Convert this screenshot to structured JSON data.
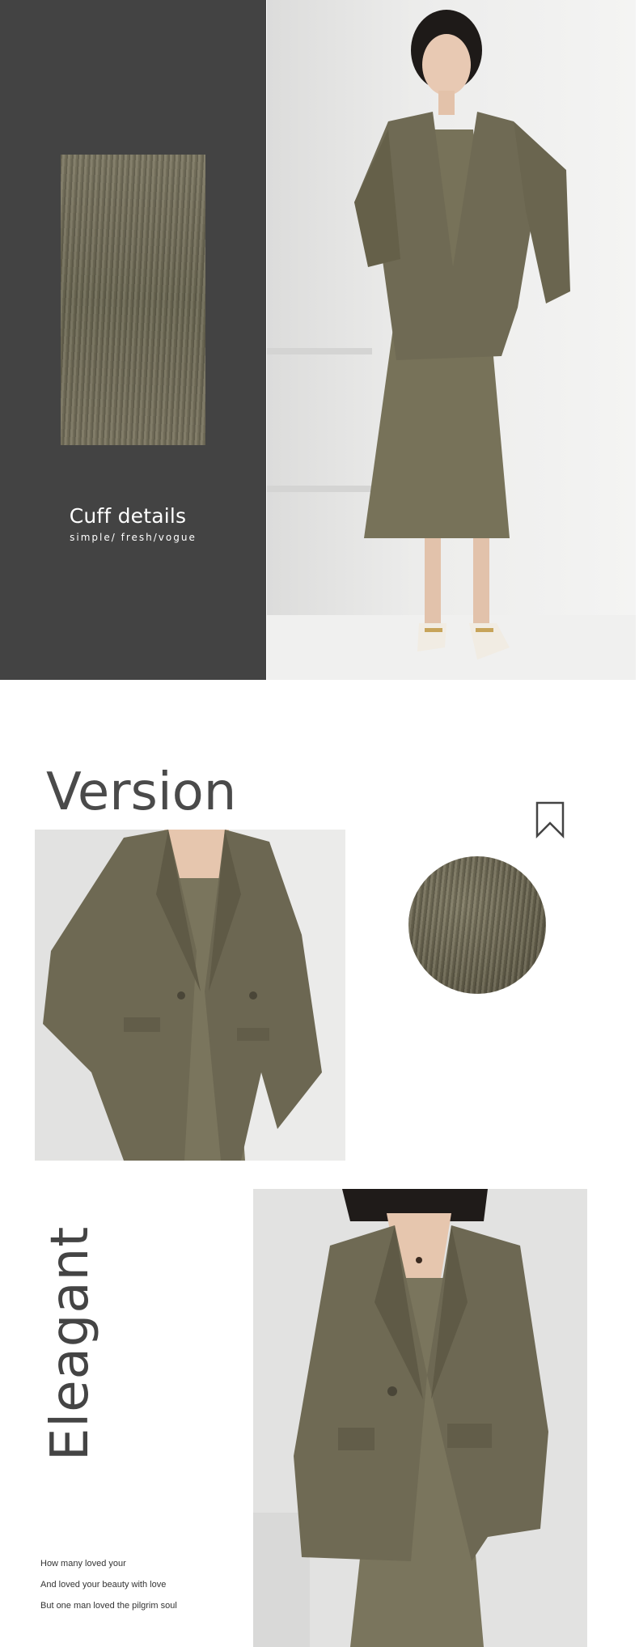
{
  "cuff": {
    "title": "Cuff details",
    "subtitle": "simple/ fresh/vogue"
  },
  "version": {
    "title": "Version"
  },
  "eleagant": {
    "word": "Eleagant",
    "poem": [
      "How many loved your",
      "And loved your beauty with love",
      "But one man loved the pilgrim soul"
    ]
  },
  "colors": {
    "dark_panel": "#434343",
    "garment_olive": "#757059",
    "heading_gray": "#454545"
  },
  "icons": [
    "bookmark-icon"
  ]
}
